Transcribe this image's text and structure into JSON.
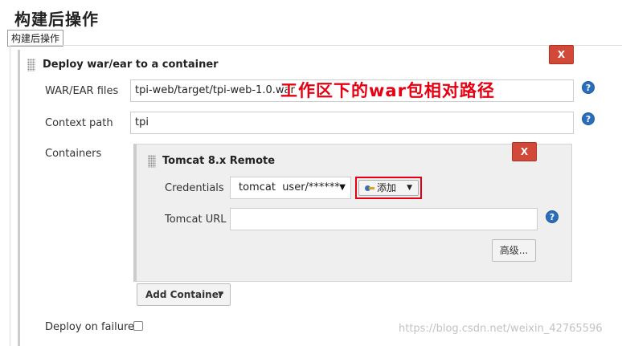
{
  "page": {
    "title": "构建后操作",
    "tooltip": "构建后操作"
  },
  "deploy_section": {
    "title": "Deploy war/ear to a container",
    "delete_label": "X",
    "war_label": "WAR/EAR files",
    "war_value": "tpi-web/target/tpi-web-1.0.war",
    "context_label": "Context path",
    "context_value": "tpi",
    "containers_label": "Containers",
    "annotation": "工作区下的war包相对路径",
    "deploy_on_failure_label": "Deploy on failure"
  },
  "container": {
    "title": "Tomcat 8.x Remote",
    "delete_label": "X",
    "credentials_label": "Credentials",
    "credentials_selected": "tomcat  user/******",
    "add_button_label": "添加",
    "tomcat_url_label": "Tomcat URL",
    "tomcat_url_value": "",
    "advanced_label": "高级...",
    "add_container_label": "Add Container"
  },
  "help_icon_glyph": "?",
  "watermark": "https://blog.csdn.net/weixin_42765596",
  "colors": {
    "delete_red": "#d24939",
    "help_blue": "#2a6ebb",
    "annotation_red": "#e60012"
  }
}
